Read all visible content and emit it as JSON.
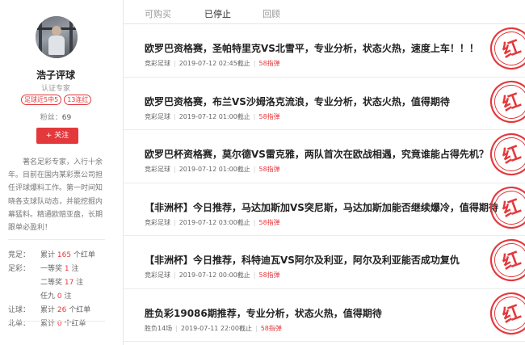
{
  "profile": {
    "name": "浩子评球",
    "cert": "认证专家",
    "badge_recent": "足球近5中5",
    "badge_streak": "13连红",
    "fans_label": "粉丝：",
    "fans_count": "69",
    "follow_label": "+ 关注",
    "bio": "著名足彩专家，入行十余年。目前在国内某彩票公司担任评球爆料工作。第一时间知晓各支球队动态，并能挖掘内幕猛料。精通欧赔亚盘，长期跟单必盈利！"
  },
  "stats": [
    {
      "label": "竞足：",
      "prefix": "累计 ",
      "num": "165",
      "suffix": " 个红单"
    },
    {
      "label": "足彩：",
      "prefix": "一等奖 ",
      "num": "1",
      "suffix": " 注"
    },
    {
      "label": "",
      "prefix": "二等奖 ",
      "num": "17",
      "suffix": " 注"
    },
    {
      "label": "",
      "prefix": "任九 ",
      "num": "0",
      "suffix": " 注"
    },
    {
      "label": "让球：",
      "prefix": "累计 ",
      "num": "26",
      "suffix": " 个红单"
    },
    {
      "label": "北单：",
      "prefix": "累计 ",
      "num": "0",
      "suffix": " 个红单"
    }
  ],
  "tabs": [
    "可购买",
    "已停止",
    "回顾"
  ],
  "active_tab": "已停止",
  "stamp_char": "红",
  "colors": {
    "accent": "#e4393c"
  },
  "articles": [
    {
      "title": "欧罗巴资格赛，圣帕特里克VS北雪平，专业分析，状态火热，速度上车！！！",
      "category": "竞彩足球",
      "time": "2019-07-12 02:45截止",
      "price": "58指弹"
    },
    {
      "title": "欧罗巴资格赛，布兰VS沙姆洛克流浪，专业分析，状态火热，值得期待",
      "category": "竞彩足球",
      "time": "2019-07-12 01:00截止",
      "price": "58指弹"
    },
    {
      "title": "欧罗巴杯资格赛，莫尔德VS雷克雅，两队首次在欧战相遇，究竟谁能占得先机？",
      "category": "竞彩足球",
      "time": "2019-07-12 01:00截止",
      "price": "58指弹"
    },
    {
      "title": "【非洲杯】今日推荐，马达加斯加VS突尼斯，马达加斯加能否继续爆冷，值得期待",
      "category": "竞彩足球",
      "time": "2019-07-12 03:00截止",
      "price": "58指弹"
    },
    {
      "title": "【非洲杯】今日推荐，科特迪瓦VS阿尔及利亚，阿尔及利亚能否成功复仇",
      "category": "竞彩足球",
      "time": "2019-07-12 00:00截止",
      "price": "58指弹"
    },
    {
      "title": "胜负彩19086期推荐，专业分析，状态火热，值得期待",
      "category": "胜负14场",
      "time": "2019-07-11 22:00截止",
      "price": "58指弹"
    }
  ]
}
